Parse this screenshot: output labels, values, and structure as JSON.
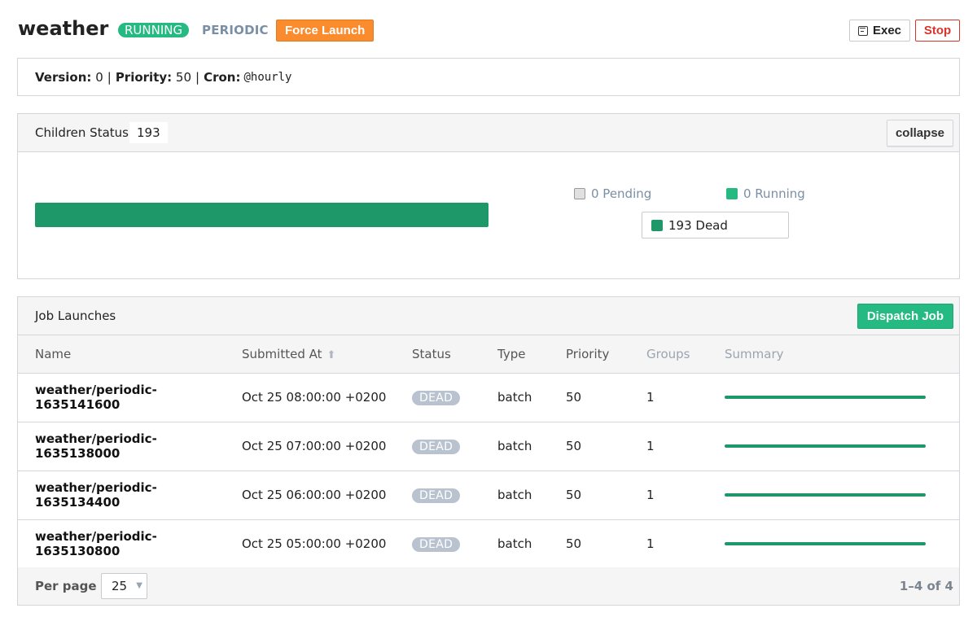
{
  "header": {
    "title": "weather",
    "status_tag": "RUNNING",
    "type_tag": "PERIODIC",
    "force_launch_label": "Force Launch",
    "exec_label": "Exec",
    "stop_label": "Stop"
  },
  "meta": {
    "version_label": "Version:",
    "version_value": "0",
    "priority_label": "Priority:",
    "priority_value": "50",
    "cron_label": "Cron:",
    "cron_value": "@hourly",
    "separator": "|"
  },
  "children": {
    "title": "Children Status",
    "count": "193",
    "collapse_label": "collapse",
    "dead_fraction": 1.0,
    "legend": {
      "pending": "0 Pending",
      "running": "0 Running",
      "dead": "193 Dead"
    }
  },
  "launches": {
    "title": "Job Launches",
    "dispatch_label": "Dispatch Job",
    "columns": [
      "Name",
      "Submitted At",
      "Status",
      "Type",
      "Priority",
      "Groups",
      "Summary"
    ],
    "sort_indicator": "⬆",
    "rows": [
      {
        "name": "weather/periodic-1635141600",
        "submitted": "Oct 25 08:00:00 +0200",
        "status": "DEAD",
        "type": "batch",
        "priority": "50",
        "groups": "1"
      },
      {
        "name": "weather/periodic-1635138000",
        "submitted": "Oct 25 07:00:00 +0200",
        "status": "DEAD",
        "type": "batch",
        "priority": "50",
        "groups": "1"
      },
      {
        "name": "weather/periodic-1635134400",
        "submitted": "Oct 25 06:00:00 +0200",
        "status": "DEAD",
        "type": "batch",
        "priority": "50",
        "groups": "1"
      },
      {
        "name": "weather/periodic-1635130800",
        "submitted": "Oct 25 05:00:00 +0200",
        "status": "DEAD",
        "type": "batch",
        "priority": "50",
        "groups": "1"
      }
    ],
    "per_page_label": "Per page",
    "per_page_value": "25",
    "page_info": "1–4 of 4"
  },
  "colors": {
    "running": "#25ba81",
    "dead": "#1e9868",
    "force_launch": "#fa8c2e",
    "stop": "#d9342b"
  }
}
